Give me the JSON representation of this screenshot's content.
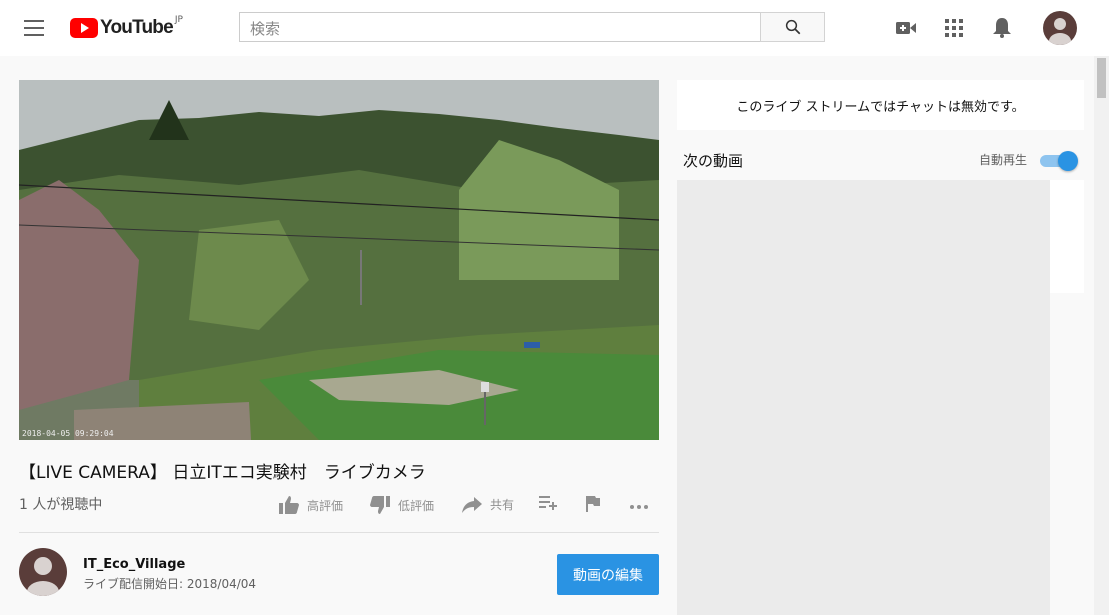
{
  "header": {
    "logo_text": "YouTube",
    "logo_region": "JP",
    "search_placeholder": "検索",
    "icons": [
      "menu-icon",
      "search-icon",
      "create-video-icon",
      "apps-icon",
      "notifications-icon",
      "account-avatar"
    ]
  },
  "player": {
    "timestamp_overlay": "2018-04-05 09:29:04"
  },
  "video": {
    "title": "【LIVE CAMERA】 日立ITエコ実験村　ライブカメラ",
    "viewers": "1 人が視聴中",
    "actions": {
      "like_label": "高評価",
      "dislike_label": "低評価",
      "share_label": "共有"
    }
  },
  "channel": {
    "name": "IT_Eco_Village",
    "stream_started": "ライブ配信開始日: 2018/04/04",
    "edit_button_label": "動画の編集"
  },
  "sidebar": {
    "chat_disabled_message": "このライブ ストリームではチャットは無効です。",
    "up_next_label": "次の動画",
    "autoplay_label": "自動再生",
    "autoplay_on": true
  },
  "colors": {
    "brand_red": "#ff0000",
    "accent_blue": "#2a93e3"
  }
}
